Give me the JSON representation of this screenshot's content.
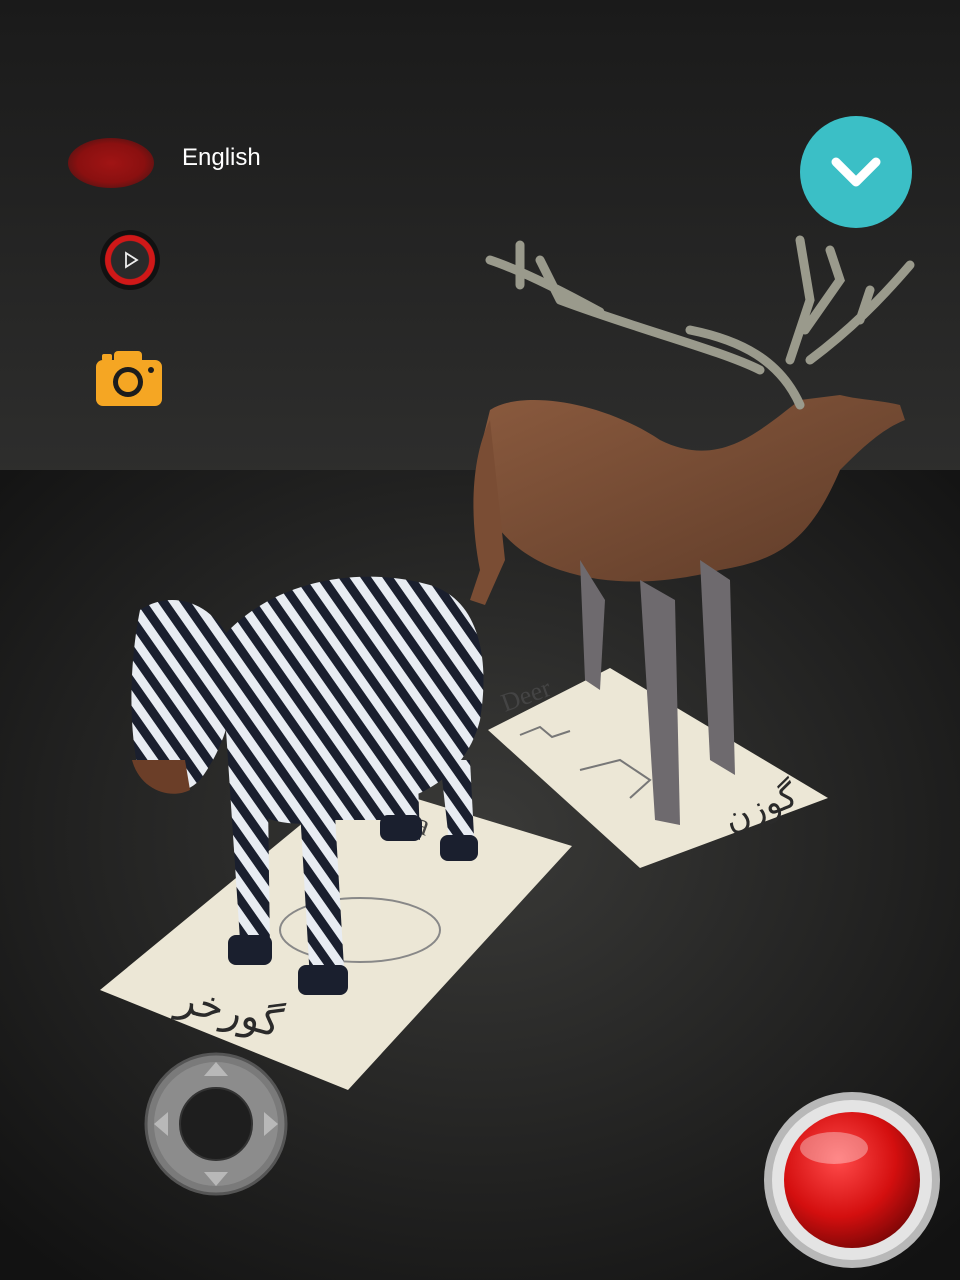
{
  "language": {
    "label": "English",
    "indicator_color": "#9a1212"
  },
  "controls": {
    "play_icon": "play-icon",
    "camera_icon": "camera-icon",
    "dropdown_icon": "chevron-down-icon",
    "joystick_icon": "joystick-icon",
    "record_icon": "record-icon"
  },
  "cards": {
    "zebra": {
      "english": "Zebra",
      "persian": "گورخر"
    },
    "deer": {
      "english": "Deer",
      "persian": "گوزن"
    }
  },
  "colors": {
    "accent": "#3bbfc6",
    "camera": "#f5a623",
    "record": "#d40f0f",
    "background": "#1c1c1c"
  }
}
